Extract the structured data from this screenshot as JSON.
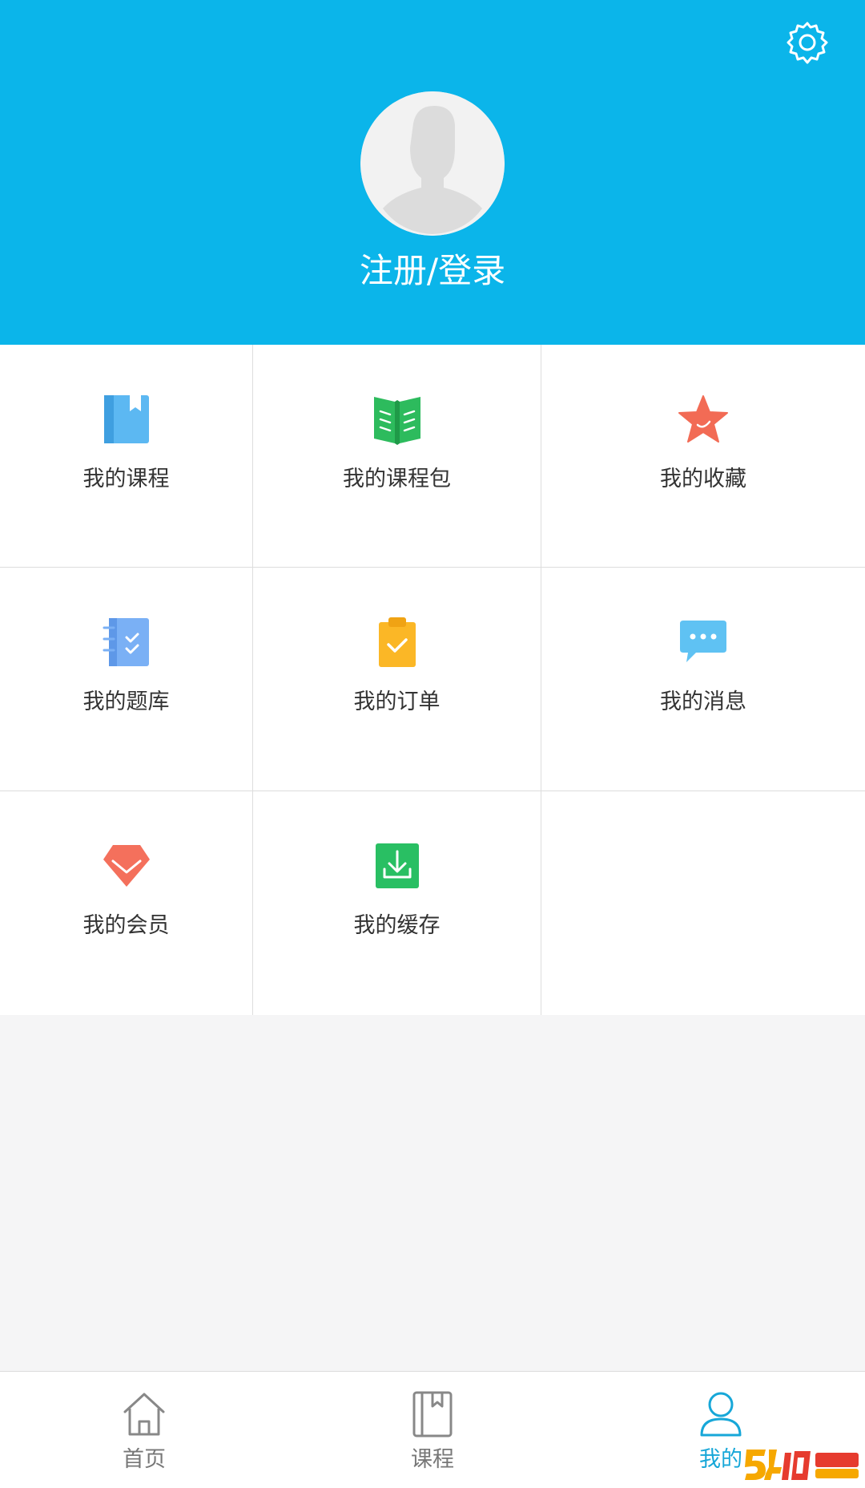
{
  "header": {
    "login_label": "注册/登录",
    "background_color": "#0bb5ea"
  },
  "menu": {
    "items": [
      {
        "label": "我的课程",
        "icon": "book-icon"
      },
      {
        "label": "我的课程包",
        "icon": "open-book-icon"
      },
      {
        "label": "我的收藏",
        "icon": "star-icon"
      },
      {
        "label": "我的题库",
        "icon": "question-bank-icon"
      },
      {
        "label": "我的订单",
        "icon": "clipboard-check-icon"
      },
      {
        "label": "我的消息",
        "icon": "chat-bubble-icon"
      },
      {
        "label": "我的会员",
        "icon": "diamond-icon"
      },
      {
        "label": "我的缓存",
        "icon": "download-icon"
      }
    ]
  },
  "tabbar": {
    "tabs": [
      {
        "label": "首页",
        "icon": "home-icon",
        "active": false
      },
      {
        "label": "课程",
        "icon": "book-outline-icon",
        "active": false
      },
      {
        "label": "我的",
        "icon": "user-icon",
        "active": true
      }
    ],
    "active_color": "#17a7d8"
  },
  "icons": {
    "settings": "gear-icon",
    "avatar": "avatar-placeholder-icon"
  }
}
